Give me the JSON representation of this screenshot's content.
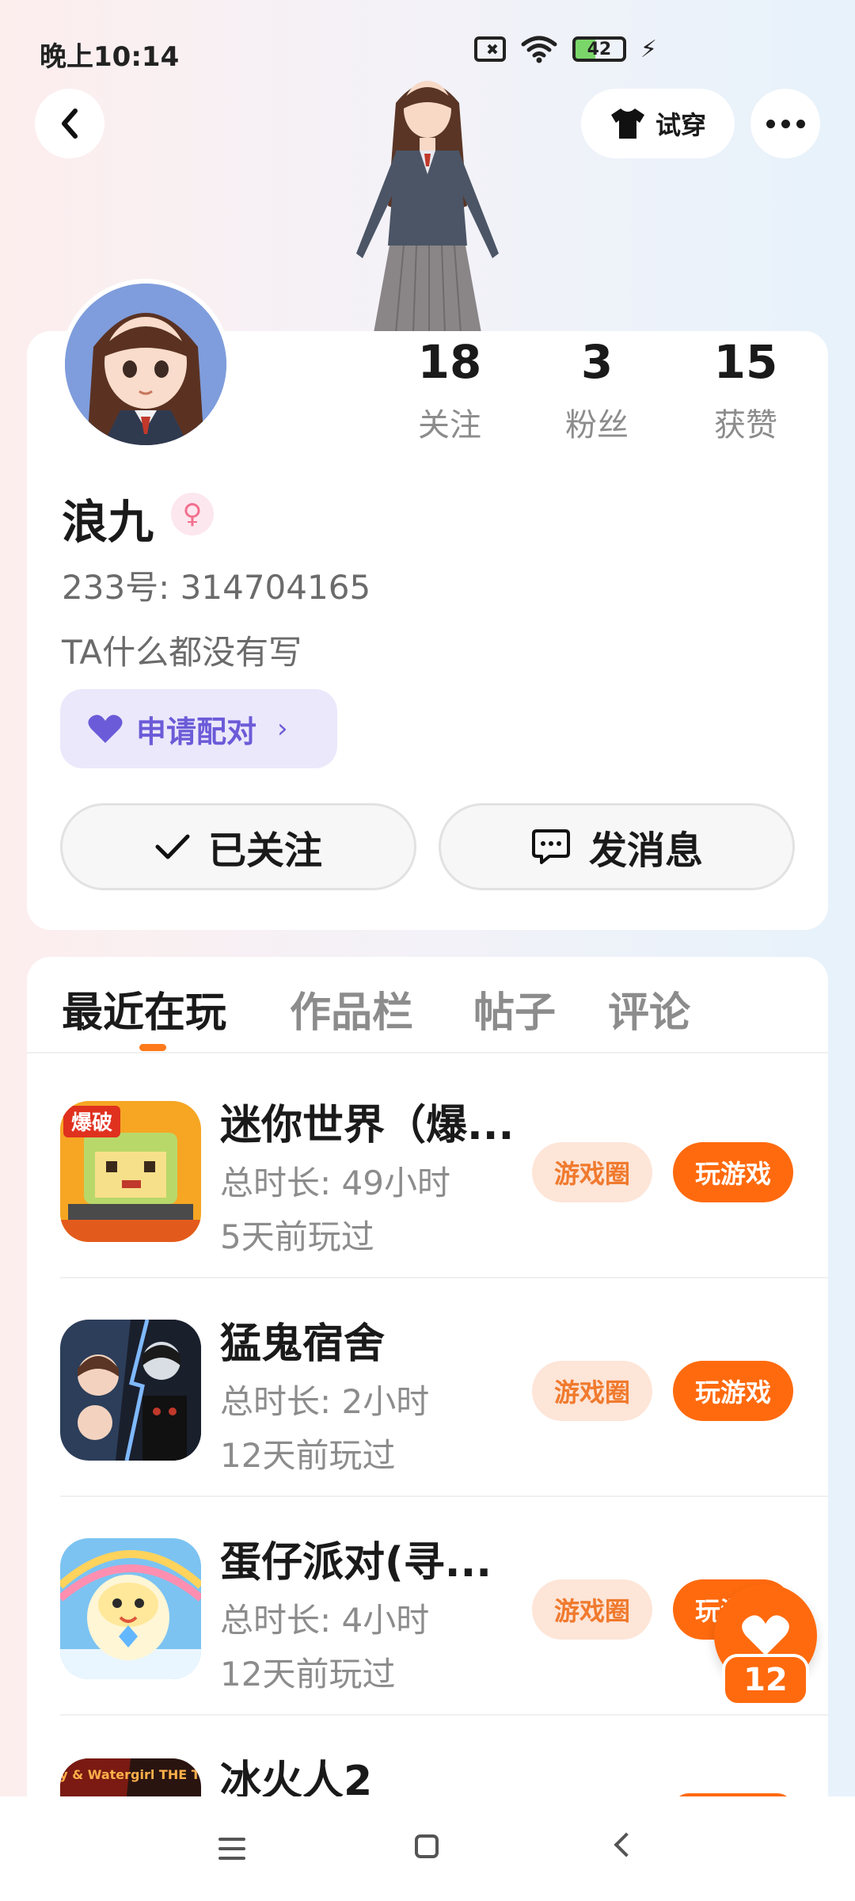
{
  "status_bar": {
    "time": "晚上10:14",
    "battery": "42",
    "battery_level": 0.42
  },
  "header": {
    "tryon_label": "试穿"
  },
  "profile": {
    "name": "浪九",
    "gender_symbol": "♀",
    "id_text": "233号: 314704165",
    "bio": "TA什么都没有写",
    "match_label": "申请配对",
    "stats": [
      {
        "value": "18",
        "label": "关注"
      },
      {
        "value": "3",
        "label": "粉丝"
      },
      {
        "value": "15",
        "label": "获赞"
      }
    ],
    "follow_label": "已关注",
    "message_label": "发消息"
  },
  "tabs": [
    "最近在玩",
    "作品栏",
    "帖子",
    "评论"
  ],
  "games": [
    {
      "title": "迷你世界（爆...",
      "duration": "总时长: 49小时",
      "last_played": "5天前玩过",
      "circle_label": "游戏圈",
      "play_label": "玩游戏",
      "icon_text": "爆破"
    },
    {
      "title": "猛鬼宿舍",
      "duration": "总时长: 2小时",
      "last_played": "12天前玩过",
      "circle_label": "游戏圈",
      "play_label": "玩游戏"
    },
    {
      "title": "蛋仔派对(寻...",
      "duration": "总时长: 4小时",
      "last_played": "12天前玩过",
      "circle_label": "游戏圈",
      "play_label": "玩游戏"
    },
    {
      "title": "冰火人2",
      "icon_text": "Fireboy & Watergirl THE TEMPLE"
    }
  ],
  "like_fab": {
    "count": "12"
  },
  "colors": {
    "accent": "#ff6a0e",
    "match": "#6b5bd8",
    "card": "#ffffff"
  }
}
